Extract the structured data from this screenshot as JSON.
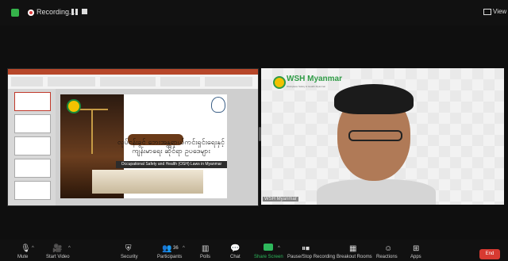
{
  "top": {
    "recording_label": "Recording...",
    "view_label": "View"
  },
  "slide": {
    "title_line1": "လုပ်ငန်းခွင် ဘေးအန္တရာယ်ကင်းရှင်းရေးနှင့်",
    "title_line2": "ကျန်းမာရေး ဆိုင်ရာ ဥပဒေများ",
    "band_text": "Occupational Safety and Health (OSH) Laws in Myanmar"
  },
  "video": {
    "org_title": "WSH Myanmar",
    "org_subtitle": "Workplace Safety & Health Myanmar",
    "participant_name": "WSH Myanmar"
  },
  "toolbar": {
    "mute_label": "Mute",
    "video_label": "Start Video",
    "security_label": "Security",
    "participants_label": "Participants",
    "participants_count": "36",
    "polls_label": "Polls",
    "chat_label": "Chat",
    "share_label": "Share Screen",
    "recording_label": "Pause/Stop Recording",
    "breakout_label": "Breakout Rooms",
    "reactions_label": "Reactions",
    "apps_label": "Apps",
    "end_label": "End"
  },
  "colors": {
    "accent_green": "#2e9b45",
    "end_red": "#d73a31",
    "record_red": "#e03c3c"
  }
}
